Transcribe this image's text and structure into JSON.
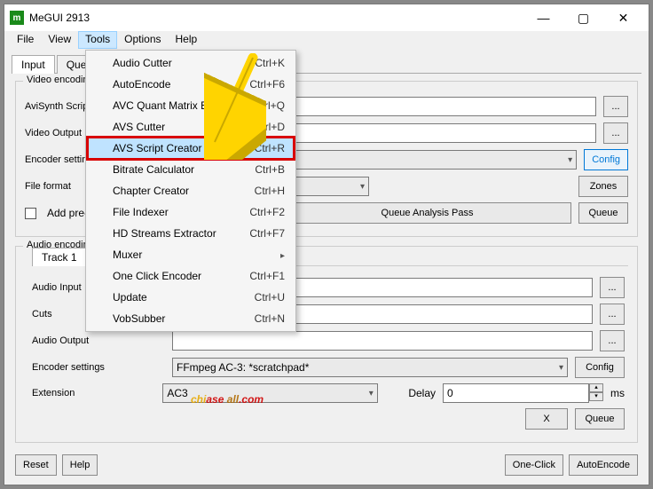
{
  "window": {
    "title": "MeGUI 2913"
  },
  "menubar": [
    "File",
    "View",
    "Tools",
    "Options",
    "Help"
  ],
  "tabs": [
    "Input",
    "Queue"
  ],
  "groups": {
    "video": "Video encoding",
    "audio": "Audio encoding"
  },
  "video": {
    "avisynth_label": "AviSynth Script",
    "output_label": "Video Output",
    "encoder_label": "Encoder settings",
    "format_label": "File format",
    "addprejob_label": "Add pre-rendering job",
    "config": "Config",
    "zones": "Zones",
    "queue": "Queue",
    "queue_analysis": "Queue Analysis Pass",
    "dots": "..."
  },
  "audio": {
    "track_tab": "Track 1",
    "input_label": "Audio Input",
    "cuts_label": "Cuts",
    "output_label": "Audio Output",
    "encoder_label": "Encoder settings",
    "encoder_value": "FFmpeg AC-3: *scratchpad*",
    "config": "Config",
    "ext_label": "Extension",
    "ext_value": "AC3",
    "delay_label": "Delay",
    "delay_value": "0",
    "ms": "ms",
    "x": "X",
    "queue": "Queue"
  },
  "footer": {
    "reset": "Reset",
    "help": "Help",
    "oneclick": "One-Click",
    "autoencode": "AutoEncode"
  },
  "tools_menu": [
    {
      "label": "Audio Cutter",
      "shortcut": "Ctrl+K"
    },
    {
      "label": "AutoEncode",
      "shortcut": "Ctrl+F6"
    },
    {
      "label": "AVC Quant Matrix Editor",
      "shortcut": "Ctrl+Q"
    },
    {
      "label": "AVS Cutter",
      "shortcut": "Ctrl+D"
    },
    {
      "label": "AVS Script Creator",
      "shortcut": "Ctrl+R",
      "hl": true
    },
    {
      "label": "Bitrate Calculator",
      "shortcut": "Ctrl+B"
    },
    {
      "label": "Chapter Creator",
      "shortcut": "Ctrl+H"
    },
    {
      "label": "File Indexer",
      "shortcut": "Ctrl+F2"
    },
    {
      "label": "HD Streams Extractor",
      "shortcut": "Ctrl+F7"
    },
    {
      "label": "Muxer",
      "submenu": true
    },
    {
      "label": "One Click Encoder",
      "shortcut": "Ctrl+F1"
    },
    {
      "label": "Update",
      "shortcut": "Ctrl+U"
    },
    {
      "label": "VobSubber",
      "shortcut": "Ctrl+N"
    }
  ],
  "watermark": {
    "p1": "chi",
    "p2": "ase",
    "p3": " all",
    "p4": ".com"
  }
}
